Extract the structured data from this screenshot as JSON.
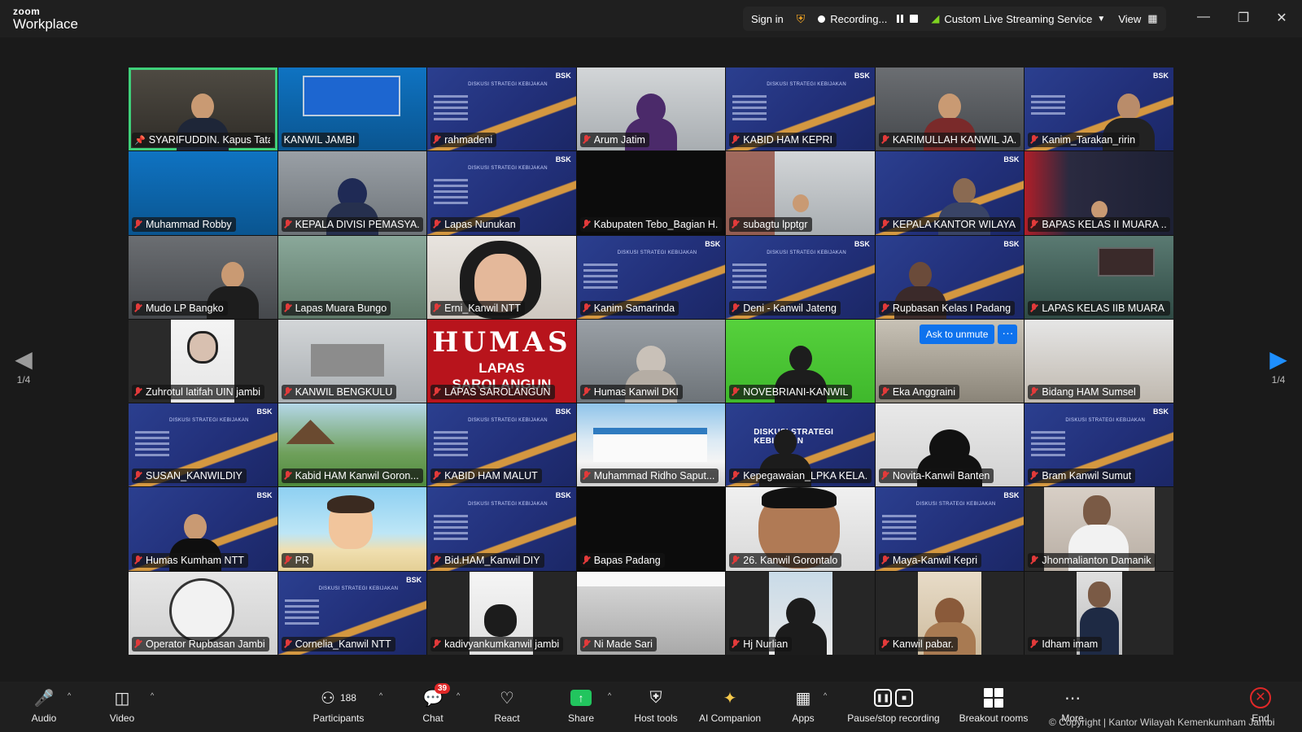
{
  "app": {
    "logo_top": "zoom",
    "logo_bottom": "Workplace"
  },
  "topbar": {
    "sign_in": "Sign in",
    "recording": "Recording...",
    "streaming": "Custom Live Streaming Service",
    "view": "View"
  },
  "gallery": {
    "page_left": "1/4",
    "page_right": "1/4",
    "ask_to_unmute": "Ask to unmute",
    "more": "···",
    "tiles": [
      {
        "name": "SYARIFUDDIN. Kapus Tata..."
      },
      {
        "name": "KANWIL JAMBI"
      },
      {
        "name": "rahmadeni"
      },
      {
        "name": "Arum Jatim"
      },
      {
        "name": "KABID HAM KEPRI"
      },
      {
        "name": "KARIMULLAH KANWIL JA..."
      },
      {
        "name": "Kanim_Tarakan_ririn"
      },
      {
        "name": "Muhammad Robby"
      },
      {
        "name": "KEPALA DIVISI PEMASYA..."
      },
      {
        "name": "Lapas Nunukan"
      },
      {
        "name": "Kabupaten Tebo_Bagian H..."
      },
      {
        "name": "subagtu lpptgr"
      },
      {
        "name": "KEPALA KANTOR WILAYA..."
      },
      {
        "name": "BAPAS KELAS II MUARA ..."
      },
      {
        "name": "Mudo LP Bangko"
      },
      {
        "name": "Lapas Muara Bungo"
      },
      {
        "name": "Erni_Kanwil NTT"
      },
      {
        "name": "Kanim Samarinda"
      },
      {
        "name": "Deni - Kanwil Jateng"
      },
      {
        "name": "Rupbasan Kelas I Padang"
      },
      {
        "name": "LAPAS KELAS IIB MUARA ..."
      },
      {
        "name": "Zuhrotul latifah UIN jambi"
      },
      {
        "name": "KANWIL BENGKULU"
      },
      {
        "name": "LAPAS SAROLANGUN"
      },
      {
        "name": "Humas Kanwil DKI"
      },
      {
        "name": "NOVEBRIANI-KANWIL"
      },
      {
        "name": "Eka Anggraini"
      },
      {
        "name": "Bidang HAM Sumsel"
      },
      {
        "name": "SUSAN_KANWILDIY"
      },
      {
        "name": "Kabid HAM Kanwil Goron..."
      },
      {
        "name": "KABID HAM MALUT"
      },
      {
        "name": "Muhammad Ridho Saput..."
      },
      {
        "name": "Kepegawaian_LPKA KELA..."
      },
      {
        "name": "Novita-Kanwil Banten"
      },
      {
        "name": "Bram Kanwil Sumut"
      },
      {
        "name": "Humas Kumham NTT"
      },
      {
        "name": "PR"
      },
      {
        "name": "Bid.HAM_Kanwil DIY"
      },
      {
        "name": "Bapas Padang"
      },
      {
        "name": "26. Kanwil Gorontalo"
      },
      {
        "name": "Maya-Kanwil Kepri"
      },
      {
        "name": "Jhonmalianton Damanik"
      },
      {
        "name": "Operator Rupbasan Jambi"
      },
      {
        "name": "Cornelia_Kanwil NTT"
      },
      {
        "name": "kadivyankumkanwil jambi"
      },
      {
        "name": "Ni Made Sari"
      },
      {
        "name": "Hj Nurlian"
      },
      {
        "name": "Kanwil pabar."
      },
      {
        "name": "Idham imam"
      }
    ],
    "slide_brand": "BSK",
    "slide_heading": "DISKUSI STRATEGI KEBIJAKAN",
    "redbrand_line1": "HUMAS",
    "redbrand_line2": "LAPAS SAROLANGUN"
  },
  "toolbar": {
    "audio": "Audio",
    "video": "Video",
    "participants": "Participants",
    "participants_count": "188",
    "chat": "Chat",
    "chat_badge": "39",
    "react": "React",
    "share": "Share",
    "host_tools": "Host tools",
    "ai_companion": "AI Companion",
    "apps": "Apps",
    "pause_stop_recording": "Pause/stop recording",
    "breakout_rooms": "Breakout rooms",
    "more": "More",
    "end": "End"
  },
  "copyright": "© Copyright | Kantor Wilayah Kemenkumham Jambi",
  "colors": {
    "active_speaker": "#3fd07a",
    "accent_blue": "#0e72ed",
    "end_red": "#e02828",
    "share_green": "#22c55e"
  }
}
